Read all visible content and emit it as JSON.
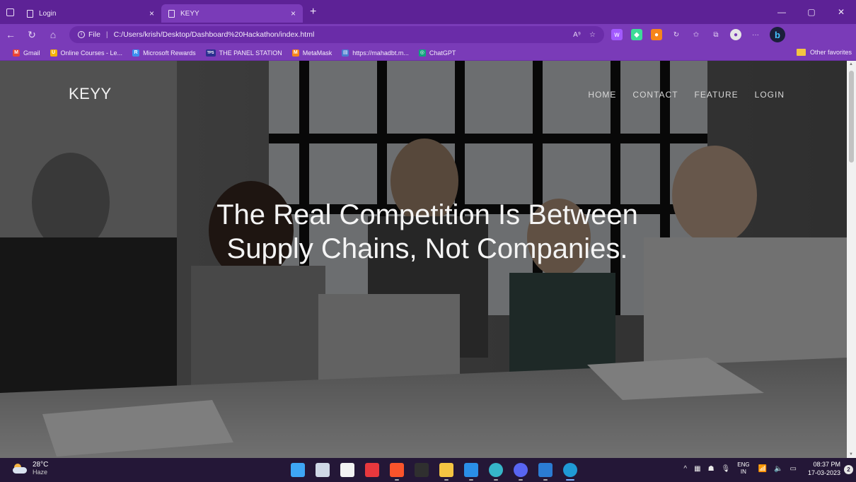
{
  "browser": {
    "tabs": [
      {
        "label": "Login"
      },
      {
        "label": "KEYY"
      }
    ],
    "tab_close": "×",
    "new_tab": "+",
    "window_controls": {
      "minimize": "—",
      "restore": "▢",
      "close": "✕"
    },
    "address": {
      "protocol": "File",
      "separator": "|",
      "url": "C:/Users/krish/Desktop/Dashboard%20Hackathon/index.html",
      "read_aloud": "A⁹",
      "more": "···"
    },
    "favorites": [
      {
        "label": "Gmail",
        "color": "#ea4335",
        "glyph": "M"
      },
      {
        "label": "Online Courses - Le...",
        "color": "#f4b400",
        "glyph": "U"
      },
      {
        "label": "Microsoft Rewards",
        "color": "#3c8ff0",
        "glyph": "R"
      },
      {
        "label": "THE PANEL STATION",
        "color": "#2a2f8f",
        "glyph": "TPS"
      },
      {
        "label": "MetaMask",
        "color": "#f6851b",
        "glyph": "M"
      },
      {
        "label": "https://mahadbt.m...",
        "color": "#4a7bd0",
        "glyph": "▤"
      },
      {
        "label": "ChatGPT",
        "color": "#10a37f",
        "glyph": "◎"
      }
    ],
    "other_favorites": "Other favorites",
    "extension_colors": [
      "#a259ff",
      "#3ddc97",
      "#f6851b"
    ]
  },
  "page": {
    "logo": "KEYY",
    "nav": [
      "HOME",
      "CONTACT",
      "FEATURE",
      "LOGIN"
    ],
    "hero": "The Real Competition Is Between Supply Chains, Not Companies."
  },
  "taskbar": {
    "weather": {
      "temp": "28°C",
      "condition": "Haze"
    },
    "apps": [
      {
        "name": "start",
        "color": "#3ea6f5"
      },
      {
        "name": "task-view",
        "color": "#cfd8e6"
      },
      {
        "name": "store",
        "color": "#f2f2f2"
      },
      {
        "name": "app-red",
        "color": "#e8383d"
      },
      {
        "name": "brave",
        "color": "#fb542b"
      },
      {
        "name": "epic-games",
        "color": "#2f2f2f"
      },
      {
        "name": "file-explorer",
        "color": "#f4c542"
      },
      {
        "name": "vscode",
        "color": "#2a8fe8"
      },
      {
        "name": "edge-dev",
        "color": "#36b6c9"
      },
      {
        "name": "discord",
        "color": "#5865f2"
      },
      {
        "name": "word",
        "color": "#2b7cd3"
      },
      {
        "name": "edge",
        "color": "#1f9ad6"
      }
    ],
    "lang": {
      "line1": "ENG",
      "line2": "IN"
    },
    "time": "08:37 PM",
    "date": "17-03-2023",
    "notifications": "2"
  }
}
